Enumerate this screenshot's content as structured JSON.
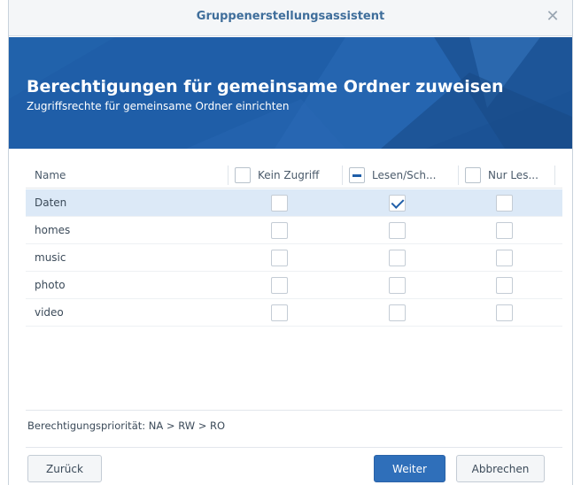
{
  "dialog": {
    "title": "Gruppenerstellungsassistent",
    "close_icon": "close-icon"
  },
  "banner": {
    "heading": "Berechtigungen für gemeinsame Ordner zuweisen",
    "subheading": "Zugriffsrechte für gemeinsame Ordner einrichten",
    "color": "#1f5ea8"
  },
  "grid": {
    "columns": {
      "name": "Name",
      "no_access": "Kein Zugriff",
      "read_write": "Lesen/Sch...",
      "read_only": "Nur Les..."
    },
    "header_checkbox_state": {
      "no_access": "unchecked",
      "read_write": "partial",
      "read_only": "unchecked"
    },
    "rows": [
      {
        "name": "Daten",
        "no_access": false,
        "read_write": true,
        "read_only": false,
        "selected": true
      },
      {
        "name": "homes",
        "no_access": false,
        "read_write": false,
        "read_only": false,
        "selected": false
      },
      {
        "name": "music",
        "no_access": false,
        "read_write": false,
        "read_only": false,
        "selected": false
      },
      {
        "name": "photo",
        "no_access": false,
        "read_write": false,
        "read_only": false,
        "selected": false
      },
      {
        "name": "video",
        "no_access": false,
        "read_write": false,
        "read_only": false,
        "selected": false
      }
    ]
  },
  "footer": {
    "priority_text": "Berechtigungspriorität: NA > RW > RO"
  },
  "buttons": {
    "back": "Zurück",
    "next": "Weiter",
    "cancel": "Abbrechen"
  }
}
